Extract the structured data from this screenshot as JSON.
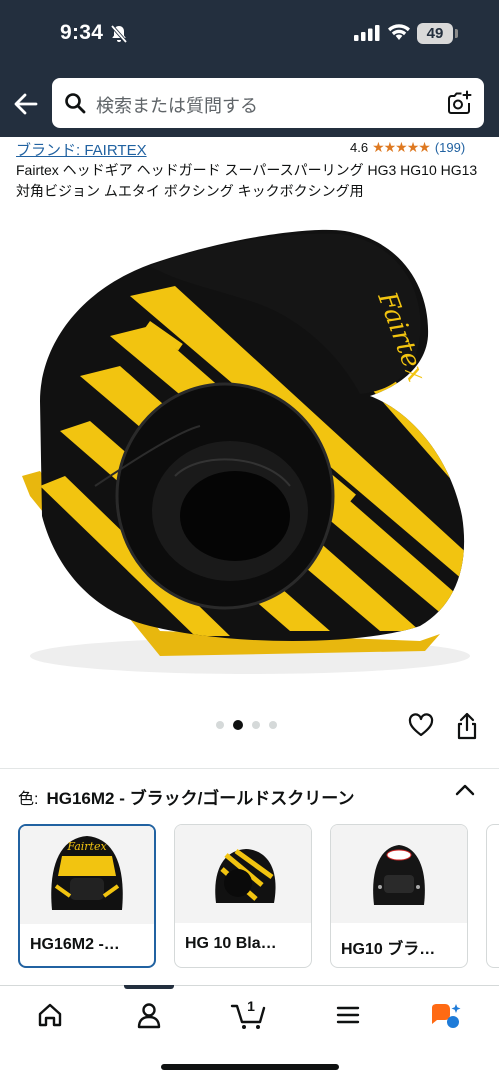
{
  "status_bar": {
    "time": "9:34",
    "battery": "49"
  },
  "search": {
    "placeholder": "検索または質問する"
  },
  "product": {
    "brand": "ブランド: FAIRTEX",
    "rating": "4.6",
    "stars": "★★★★★",
    "review_count": "(199)",
    "title": "Fairtex ヘッドギア ヘッドガード スーパースパーリング HG3 HG10 HG13 対角ビジョン ムエタイ ボクシング キックボクシング用"
  },
  "gallery": {
    "image_count": 4,
    "active_index": 1
  },
  "color": {
    "label": "色:",
    "value": "HG16M2 - ブラック/ゴールドスクリーン"
  },
  "swatches": [
    {
      "label": "HG16M2 -…",
      "selected": true
    },
    {
      "label": "HG 10 Bla…",
      "selected": false
    },
    {
      "label": "HG10 ブラ…",
      "selected": false
    }
  ],
  "nav": {
    "cart_count": "1"
  },
  "colors": {
    "header_bg": "#232f3e",
    "link": "#2162a1",
    "star": "#de7921",
    "helmet_yellow": "#f2c410"
  }
}
